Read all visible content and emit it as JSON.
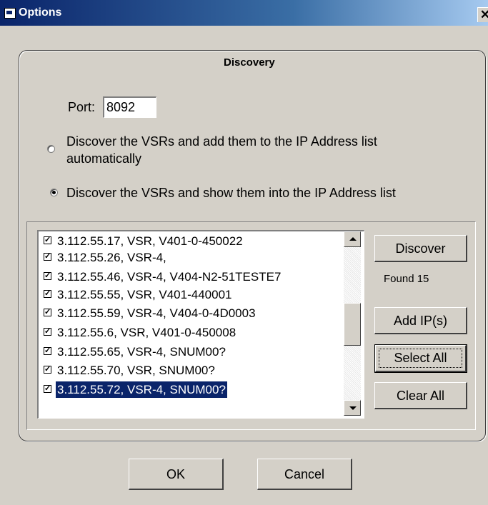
{
  "window": {
    "title": "Options",
    "close_label": "✕"
  },
  "group": {
    "title": "Discovery"
  },
  "port": {
    "label": "Port:",
    "value": "8092"
  },
  "radios": [
    {
      "line1": "Discover the VSRs and add them to the IP Address list",
      "line2": "automatically",
      "checked": false
    },
    {
      "line1": "Discover the VSRs and show them into the IP Address list",
      "checked": true
    }
  ],
  "list": {
    "items": [
      {
        "text": "3.112.55.17, VSR, V401-0-450022",
        "checked": true,
        "selected": false
      },
      {
        "text": "3.112.55.26, VSR-4,",
        "checked": true,
        "selected": false
      },
      {
        "text": "3.112.55.46, VSR-4, V404-N2-51TESTE7",
        "checked": true,
        "selected": false
      },
      {
        "text": "3.112.55.55, VSR, V401-440001",
        "checked": true,
        "selected": false
      },
      {
        "text": "3.112.55.59, VSR-4, V404-0-4D0003",
        "checked": true,
        "selected": false
      },
      {
        "text": "3.112.55.6, VSR, V401-0-450008",
        "checked": true,
        "selected": false
      },
      {
        "text": "3.112.55.65, VSR-4, SNUM00?",
        "checked": true,
        "selected": false
      },
      {
        "text": "3.112.55.70, VSR, SNUM00?",
        "checked": true,
        "selected": false
      },
      {
        "text": "3.112.55.72, VSR-4, SNUM00?",
        "checked": true,
        "selected": true
      }
    ]
  },
  "buttons": {
    "discover": "Discover",
    "found": "Found 15",
    "add_ips": "Add IP(s)",
    "select_all": "Select All",
    "clear_all": "Clear All",
    "ok": "OK",
    "cancel": "Cancel"
  },
  "icons": {
    "app": "options-window-icon",
    "check": "checkmark-icon"
  },
  "colors": {
    "title_bar": "#0a246a",
    "selection": "#0a246a",
    "dialog_bg": "#d4d0c8"
  }
}
